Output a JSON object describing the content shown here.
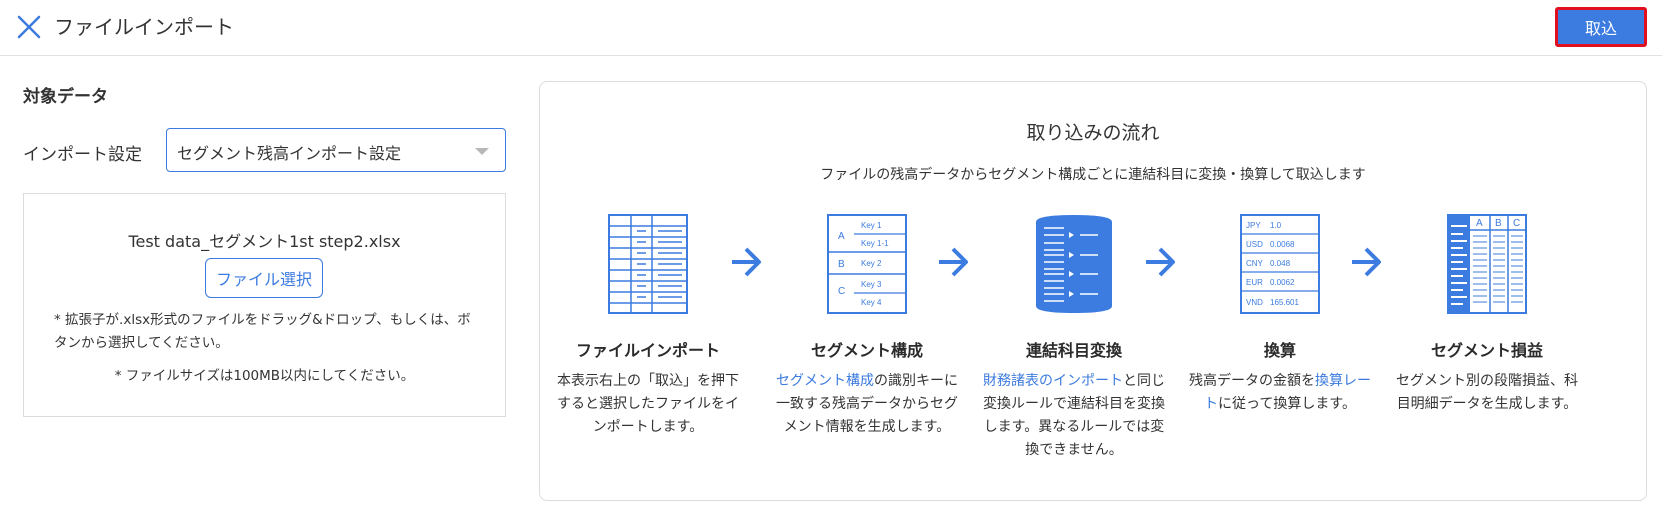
{
  "header": {
    "title": "ファイルインポート",
    "import_label": "取込"
  },
  "target": {
    "section_title": "対象データ",
    "setting_label": "インポート設定",
    "setting_value": "セグメント残高インポート設定"
  },
  "dropzone": {
    "file_name": "Test data_セグメント1st step2.xlsx",
    "select_file_label": "ファイル選択",
    "note_ext": "* 拡張子が.xlsx形式のファイルをドラッグ&ドロップ、もしくは、ボタンから選択してください。",
    "note_size": "* ファイルサイズは100MB以内にしてください。"
  },
  "flow": {
    "title": "取り込みの流れ",
    "subtitle": "ファイルの残高データからセグメント構成ごとに連結科目に変換・換算して取込します",
    "steps": [
      {
        "title": "ファイルインポート",
        "desc": "本表示右上の「取込」を押下すると選択したファイルをインポートします。",
        "icon": "spreadsheet-icon"
      },
      {
        "title": "セグメント構成",
        "link": "セグメント構成",
        "desc": "の識別キーに一致する残高データからセグメント情報を生成します。",
        "icon": "segment-keys-icon",
        "keys": [
          "Key 1",
          "Key 1-1",
          "Key 2",
          "Key 3",
          "Key 4"
        ],
        "groups": [
          "A",
          "B",
          "C"
        ]
      },
      {
        "title": "連結科目変換",
        "link": "財務諸表のインポート",
        "desc": "と同じ変換ルールで連結科目を変換します。異なるルールでは変換できません。",
        "icon": "document-list-icon"
      },
      {
        "title": "換算",
        "desc_prefix": "残高データの金額を",
        "link": "換算レート",
        "desc": "に従って換算します。",
        "icon": "currency-rate-icon",
        "rates": [
          [
            "JPY",
            "1.0"
          ],
          [
            "USD",
            "0.0068"
          ],
          [
            "CNY",
            "0.048"
          ],
          [
            "EUR",
            "0.0062"
          ],
          [
            "VND",
            "165.601"
          ]
        ]
      },
      {
        "title": "セグメント損益",
        "desc": "セグメント別の段階損益、科目明細データを生成します。",
        "icon": "profit-loss-table-icon",
        "columns": [
          "A",
          "B",
          "C"
        ]
      }
    ]
  },
  "colors": {
    "accent": "#3c7bdf",
    "highlight_border": "#e0101e",
    "border": "#dcdcdc"
  }
}
